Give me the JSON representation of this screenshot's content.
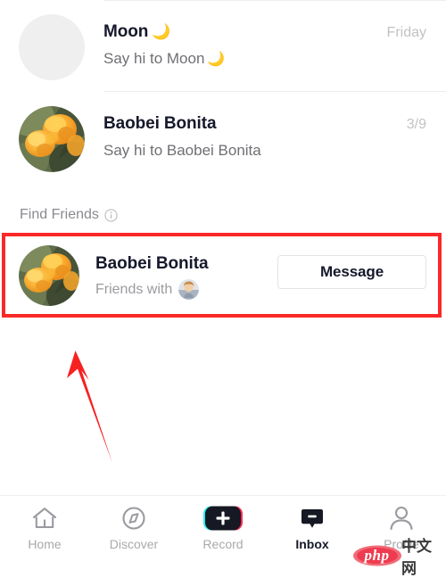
{
  "app": {
    "screen_name": "Inbox",
    "accent_red": "#fb2828",
    "text_primary": "#16182b",
    "text_secondary": "#6f6f74",
    "text_muted": "#c2c2c6"
  },
  "messages": [
    {
      "name": "Moon",
      "name_emoji": "🌙",
      "preview": "Say hi to Moon",
      "preview_emoji": "🌙",
      "time": "Friday",
      "avatar": "placeholder-gray-circle"
    },
    {
      "name": "Baobei Bonita",
      "name_emoji": "",
      "preview": "Say hi to Baobei Bonita",
      "preview_emoji": "",
      "time": "3/9",
      "avatar": "orange-flowers-photo"
    }
  ],
  "find_friends": {
    "title": "Find Friends",
    "info_icon": "info-circle-icon",
    "suggestion": {
      "name": "Baobei Bonita",
      "subtitle": "Friends with",
      "mutual_avatar": "person-thumbnail",
      "avatar": "orange-flowers-photo",
      "action_label": "Message"
    }
  },
  "annotations": {
    "highlight_box_color": "#fb2828",
    "arrow_color": "#f62121"
  },
  "bottom_nav": {
    "items": [
      {
        "label": "Home",
        "icon": "home-icon",
        "active": false
      },
      {
        "label": "Discover",
        "icon": "compass-icon",
        "active": false
      },
      {
        "label": "Record",
        "icon": "plus-record-icon",
        "active": false
      },
      {
        "label": "Inbox",
        "icon": "inbox-bubble-icon",
        "active": true
      },
      {
        "label": "Profile",
        "icon": "person-icon",
        "active": false
      }
    ]
  },
  "watermark": {
    "brand": "php",
    "suffix": "中文网"
  }
}
